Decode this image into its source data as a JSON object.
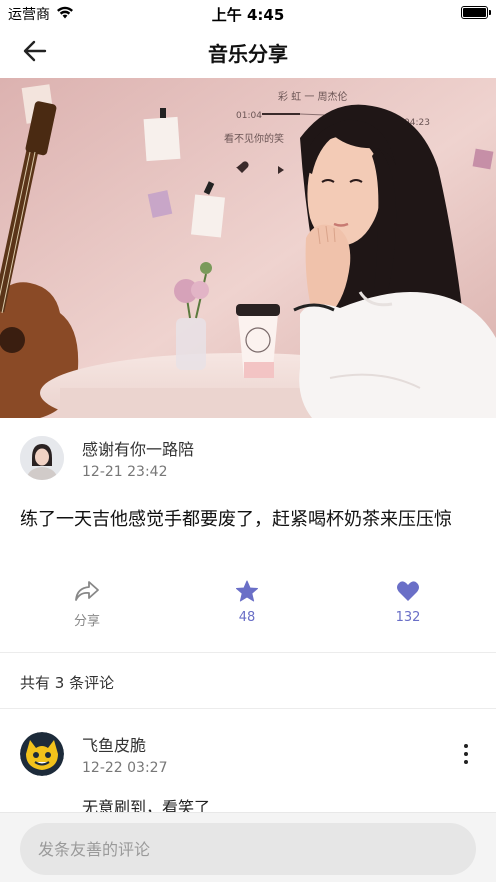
{
  "status": {
    "carrier": "运营商",
    "time": "上午 4:45"
  },
  "nav": {
    "title": "音乐分享"
  },
  "post": {
    "author": "感谢有你一路陪",
    "time": "12-21 23:42",
    "text": "练了一天吉他感觉手都要废了，赶紧喝杯奶茶来压压惊",
    "wall_text": {
      "line1": "彩 虹 一 周杰伦",
      "line2": "看不见你的笑",
      "t_start": "01:04",
      "t_end": "04:23"
    }
  },
  "actions": {
    "share_label": "分享",
    "star_count": "48",
    "like_count": "132"
  },
  "comments": {
    "header": "共有 3 条评论",
    "items": [
      {
        "name": "飞鱼皮脆",
        "time": "12-22 03:27",
        "text": "无意刷到，看笑了"
      }
    ]
  },
  "input": {
    "placeholder": "发条友善的评论"
  },
  "colors": {
    "accent": "#6a6fc7",
    "share_gray": "#888888"
  }
}
